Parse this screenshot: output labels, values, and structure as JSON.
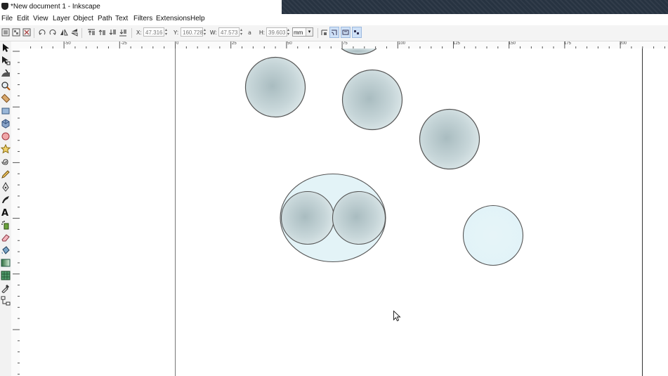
{
  "window": {
    "title": "*New document 1 - Inkscape"
  },
  "menu": {
    "items": [
      "File",
      "Edit",
      "View",
      "Layer",
      "Object",
      "Path",
      "Text",
      "Filters",
      "Extensions",
      "Help"
    ]
  },
  "toolbar": {
    "x_label": "X:",
    "x_value": "47.316",
    "y_label": "Y:",
    "y_value": "160.728",
    "w_label": "W:",
    "w_value": "47.573",
    "h_label": "H:",
    "h_value": "39.603",
    "unit": "mm"
  },
  "ruler": {
    "horizontal_labels": [
      "-50",
      "-25",
      "0",
      "25",
      "50",
      "75",
      "100",
      "125",
      "150",
      "175",
      "200"
    ]
  },
  "colors": {
    "circle_fill": "#c3d3d6",
    "circle_fill_light": "#e3f4f8",
    "circle_stroke": "#555555",
    "snap_active": "#cfe1f7"
  },
  "tools": [
    "selector-tool-icon",
    "node-tool-icon",
    "tweak-tool-icon",
    "zoom-tool-icon",
    "measure-tool-icon",
    "rectangle-tool-icon",
    "3d-box-tool-icon",
    "ellipse-tool-icon",
    "star-tool-icon",
    "spiral-tool-icon",
    "pencil-tool-icon",
    "pen-tool-icon",
    "calligraphy-tool-icon",
    "text-tool-icon",
    "spray-tool-icon",
    "eraser-tool-icon",
    "bucket-tool-icon",
    "gradient-tool-icon",
    "mesh-tool-icon",
    "dropper-tool-icon",
    "connector-tool-icon"
  ]
}
